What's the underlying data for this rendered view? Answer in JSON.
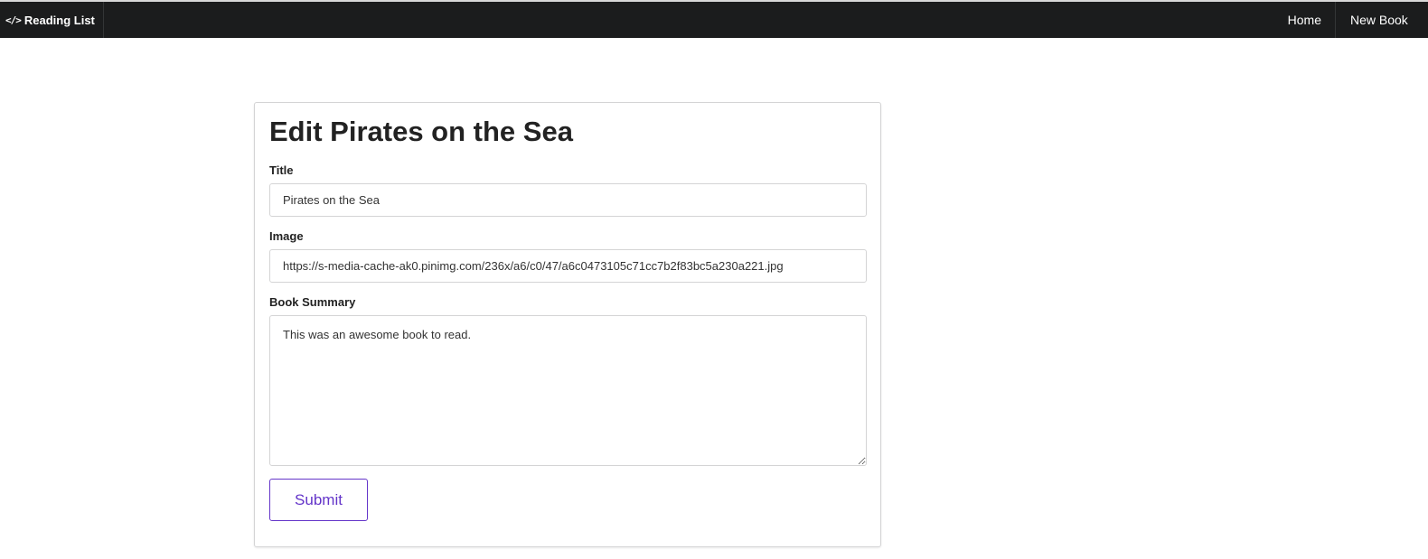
{
  "navbar": {
    "brand_icon": "code-icon",
    "brand_icon_glyph": "</>",
    "brand_label": "Reading List",
    "home_label": "Home",
    "new_book_label": "New Book"
  },
  "form": {
    "heading": "Edit Pirates on the Sea",
    "title_label": "Title",
    "title_value": "Pirates on the Sea",
    "image_label": "Image",
    "image_value": "https://s-media-cache-ak0.pinimg.com/236x/a6/c0/47/a6c0473105c71cc7b2f83bc5a230a221.jpg",
    "summary_label": "Book Summary",
    "summary_value": "This was an awesome book to read.",
    "submit_label": "Submit"
  },
  "colors": {
    "navbar_bg": "#1b1c1d",
    "accent": "#6435c9"
  }
}
